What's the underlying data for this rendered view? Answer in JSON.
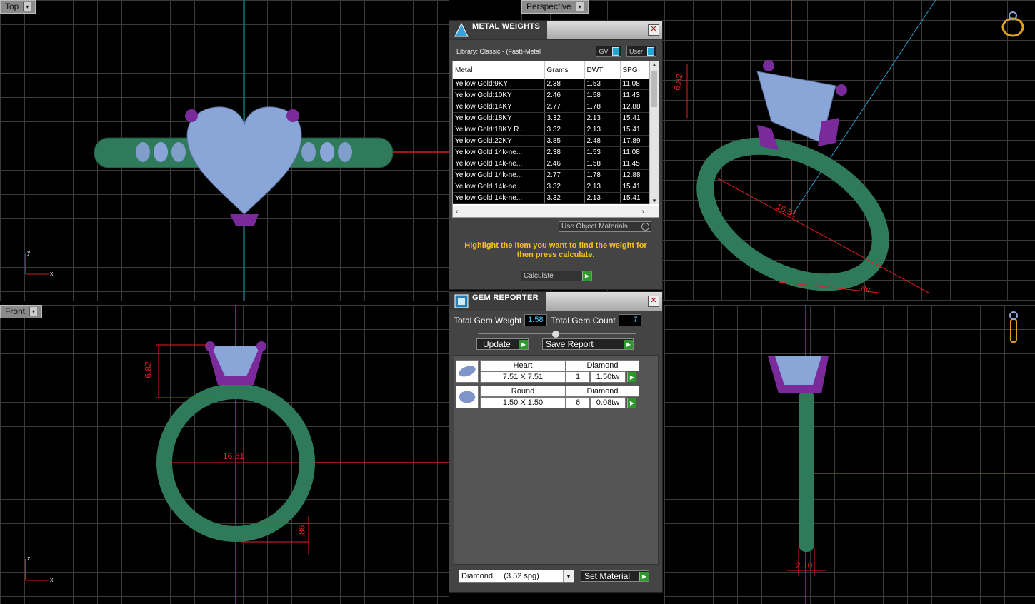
{
  "viewports": {
    "top": {
      "label": "Top",
      "axis_v": "y",
      "axis_h": "x"
    },
    "perspective": {
      "label": "Perspective"
    },
    "front": {
      "label": "Front",
      "axis_v": "z",
      "axis_h": "x"
    },
    "right": {}
  },
  "dimensions": {
    "front_height": "6.82",
    "front_diameter": "16.51",
    "front_band": ".86",
    "persp_height": "6.82",
    "persp_diameter": "16.51",
    "persp_band": ".86",
    "right_width": "2.10"
  },
  "metal_weights": {
    "title": "METAL WEIGHTS",
    "library": "Library: Classic - (Fast)-Metal",
    "gv_label": "GV",
    "user_label": "User",
    "columns": [
      "Metal",
      "Grams",
      "DWT",
      "SPG"
    ],
    "rows": [
      [
        "Yellow Gold:9KY",
        "2.38",
        "1.53",
        "11.08"
      ],
      [
        "Yellow Gold:10KY",
        "2.46",
        "1.58",
        "11.43"
      ],
      [
        "Yellow Gold:14KY",
        "2.77",
        "1.78",
        "12.88"
      ],
      [
        "Yellow Gold:18KY",
        "3.32",
        "2.13",
        "15.41"
      ],
      [
        "Yellow Gold:18KY R...",
        "3.32",
        "2.13",
        "15.41"
      ],
      [
        "Yellow Gold:22KY",
        "3.85",
        "2.48",
        "17.89"
      ],
      [
        "Yellow Gold 14k-ne...",
        "2.38",
        "1.53",
        "11.08"
      ],
      [
        "Yellow Gold 14k-ne...",
        "2.46",
        "1.58",
        "11.45"
      ],
      [
        "Yellow Gold 14k-ne...",
        "2.77",
        "1.78",
        "12.88"
      ],
      [
        "Yellow Gold 14k-ne...",
        "3.32",
        "2.13",
        "15.41"
      ],
      [
        "Yellow Gold 14k-ne...",
        "3.32",
        "2.13",
        "15.41"
      ]
    ],
    "use_object_materials": "Use Object Materials",
    "instruction": "Highlight the item you want to find the weight for then press calculate.",
    "calculate": "Calculate"
  },
  "gem_reporter": {
    "title": "GEM REPORTER",
    "total_weight_label": "Total Gem Weight",
    "total_weight": "1.58",
    "total_count_label": "Total Gem Count",
    "total_count": "7",
    "update": "Update",
    "save_report": "Save Report",
    "gems": [
      {
        "shape": "Heart",
        "material": "Diamond",
        "size": "7.51 X 7.51",
        "count": "1",
        "weight": "1.50tw"
      },
      {
        "shape": "Round",
        "material": "Diamond",
        "size": "1.50 X 1.50",
        "count": "6",
        "weight": "0.08tw"
      }
    ],
    "material_select": "Diamond     (3.52 spg)",
    "set_material": "Set Material"
  },
  "colors": {
    "band": "#2e7a5a",
    "stone": "#8aa6d8",
    "prong": "#7a2a9a",
    "dimension": "#e02020",
    "highlight": "#f6c01a",
    "accent_blue": "#29a4d6"
  },
  "icons": [
    "close-icon",
    "play-icon",
    "chevron-down-icon",
    "ring-gizmo-icon"
  ]
}
